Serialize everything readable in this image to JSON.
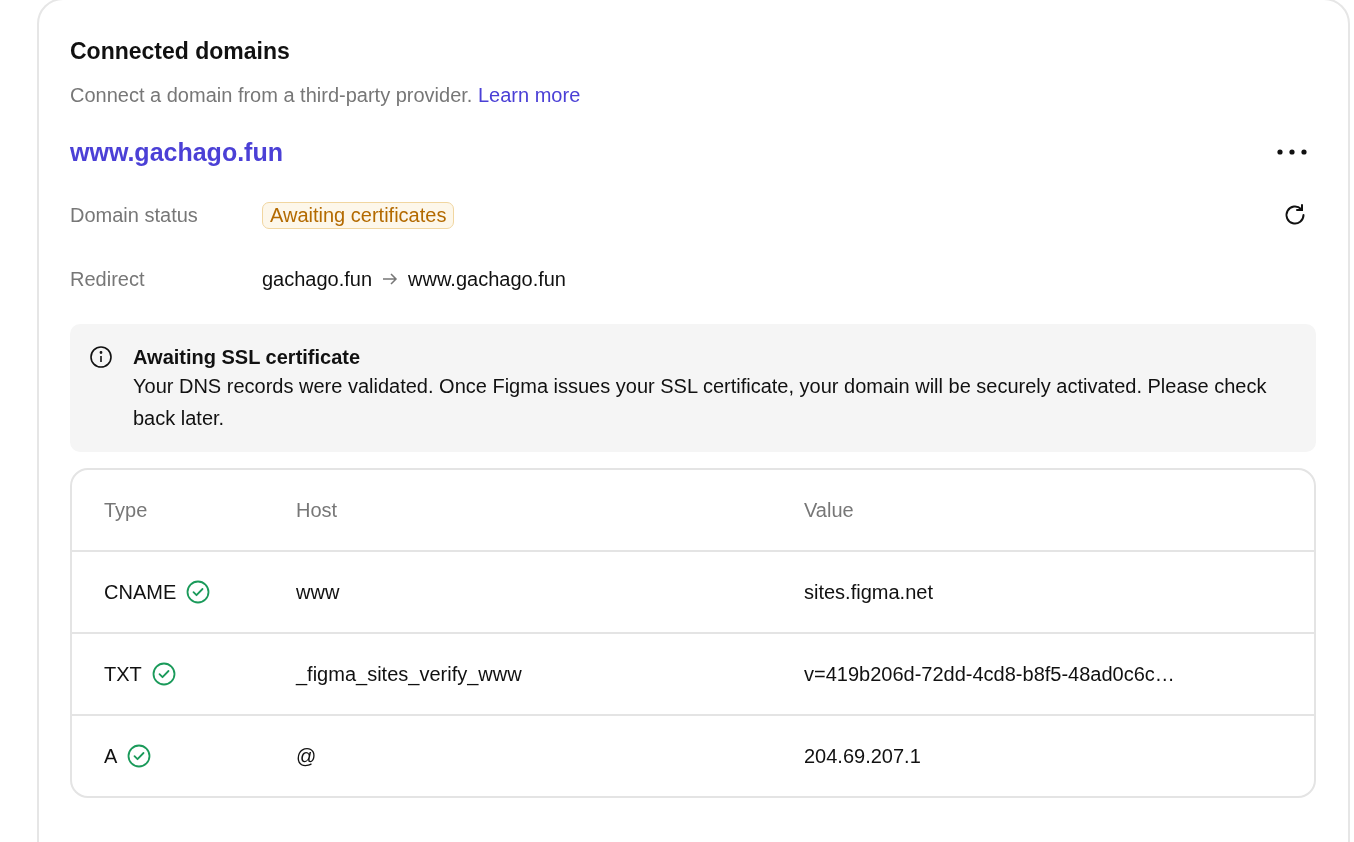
{
  "section": {
    "title": "Connected domains",
    "description": "Connect a domain from a third-party provider.",
    "link": "Learn more"
  },
  "domain": {
    "name": "www.gachago.fun",
    "status_label": "Domain status",
    "status": "Awaiting certificates",
    "redirect_label": "Redirect",
    "redirect_from": "gachago.fun",
    "redirect_to": "www.gachago.fun"
  },
  "notice": {
    "title": "Awaiting SSL certificate",
    "body": "Your DNS records were validated. Once Figma issues your SSL certificate, your domain will be securely activated. Please check back later."
  },
  "table": {
    "columns": [
      "Type",
      "Host",
      "Value"
    ],
    "rows": [
      {
        "type": "CNAME",
        "verified": true,
        "host": "www",
        "value": "sites.figma.net"
      },
      {
        "type": "TXT",
        "verified": true,
        "host": "_figma_sites_verify_www",
        "value": "v=419b206d-72dd-4cd8-b8f5-48ad0c6c…"
      },
      {
        "type": "A",
        "verified": true,
        "host": "@",
        "value": "204.69.207.1"
      }
    ]
  }
}
